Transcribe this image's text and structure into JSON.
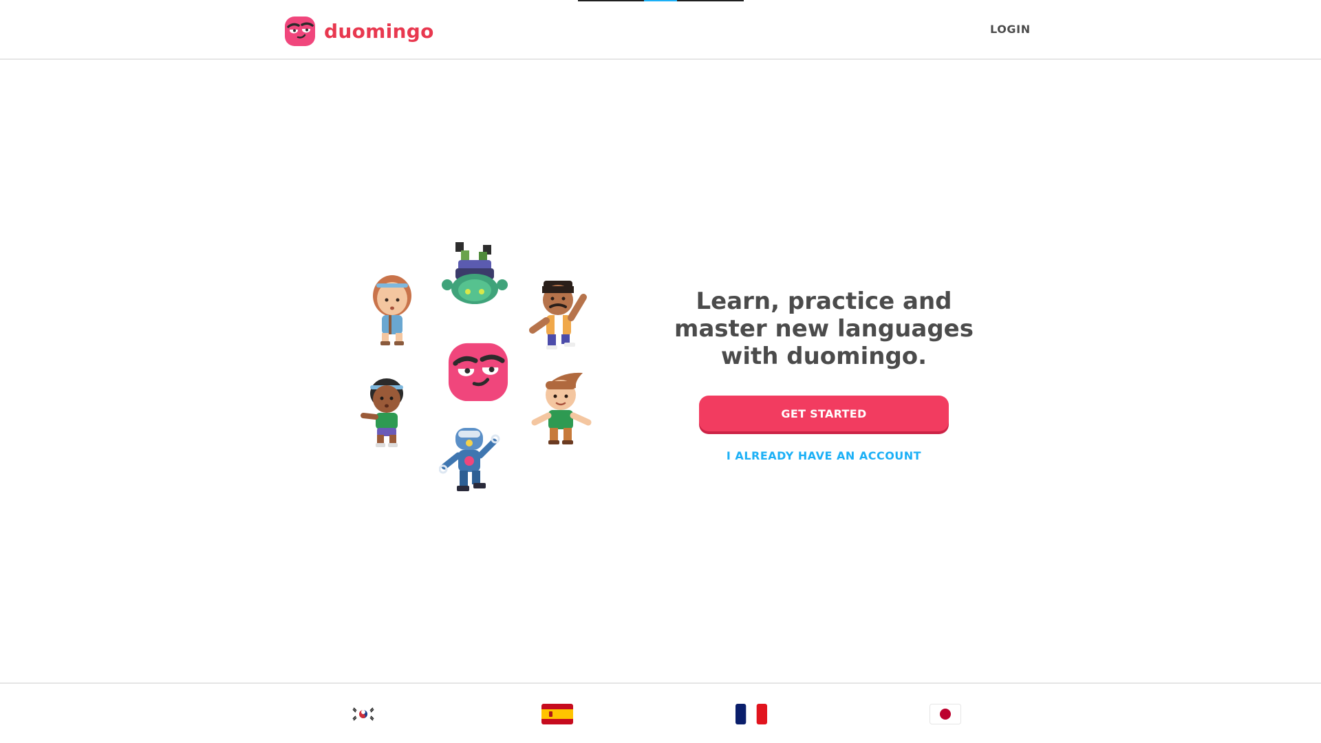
{
  "brand": {
    "name": "duomingo",
    "color": "#e8384f",
    "logo_icon": "duomingo-mascot-icon"
  },
  "header": {
    "login_label": "LOGIN"
  },
  "hero": {
    "headline": "Learn, practice and master new languages with duomingo.",
    "cta_label": "GET STARTED",
    "cta_color": "#f23c60",
    "secondary_label": "I ALREADY HAVE AN ACCOUNT",
    "secondary_color": "#1cb0f6"
  },
  "illustration": {
    "characters": [
      "girl-with-headband",
      "upside-down-zombie",
      "man-with-mustache",
      "duomingo-mascot",
      "girl-with-cap",
      "boy-with-quiff",
      "robot"
    ]
  },
  "footer": {
    "flags": [
      {
        "icon": "south-korea-flag-icon"
      },
      {
        "icon": "spain-flag-icon"
      },
      {
        "icon": "france-flag-icon"
      },
      {
        "icon": "japan-flag-icon"
      }
    ]
  }
}
